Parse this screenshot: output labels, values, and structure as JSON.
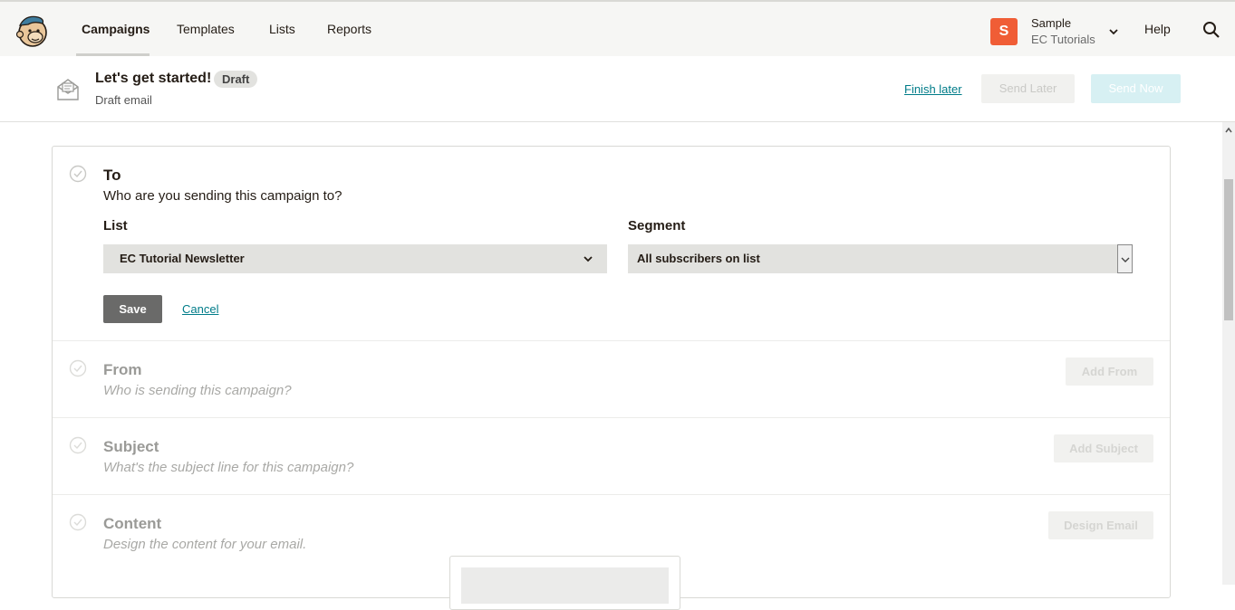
{
  "nav": {
    "items": [
      "Campaigns",
      "Templates",
      "Lists",
      "Reports"
    ],
    "account_initial": "S",
    "account_name": "Sample",
    "account_org": "EC Tutorials",
    "help": "Help"
  },
  "campaign": {
    "title": "Let's get started!",
    "badge": "Draft",
    "subtitle": "Draft email",
    "finish_later": "Finish later",
    "send_later": "Send Later",
    "send_now": "Send Now"
  },
  "to": {
    "title": "To",
    "desc": "Who are you sending this campaign to?",
    "list_label": "List",
    "list_value": "EC Tutorial Newsletter",
    "segment_label": "Segment",
    "segment_value": "All subscribers on list",
    "save": "Save",
    "cancel": "Cancel"
  },
  "from": {
    "title": "From",
    "desc": "Who is sending this campaign?",
    "button": "Add From"
  },
  "subject": {
    "title": "Subject",
    "desc": "What's the subject line for this campaign?",
    "button": "Add Subject"
  },
  "content": {
    "title": "Content",
    "desc": "Design the content for your email.",
    "button": "Design Email"
  },
  "colors": {
    "accent_link": "#007c89",
    "avatar": "#f05d36",
    "save_button": "#6a6a69",
    "send_now_disabled": "#d7f0f3"
  },
  "icons": [
    "mailchimp-logo",
    "chevron-down-icon",
    "search-icon",
    "envelope-icon",
    "check-circle-icon",
    "scroll-up-icon"
  ]
}
